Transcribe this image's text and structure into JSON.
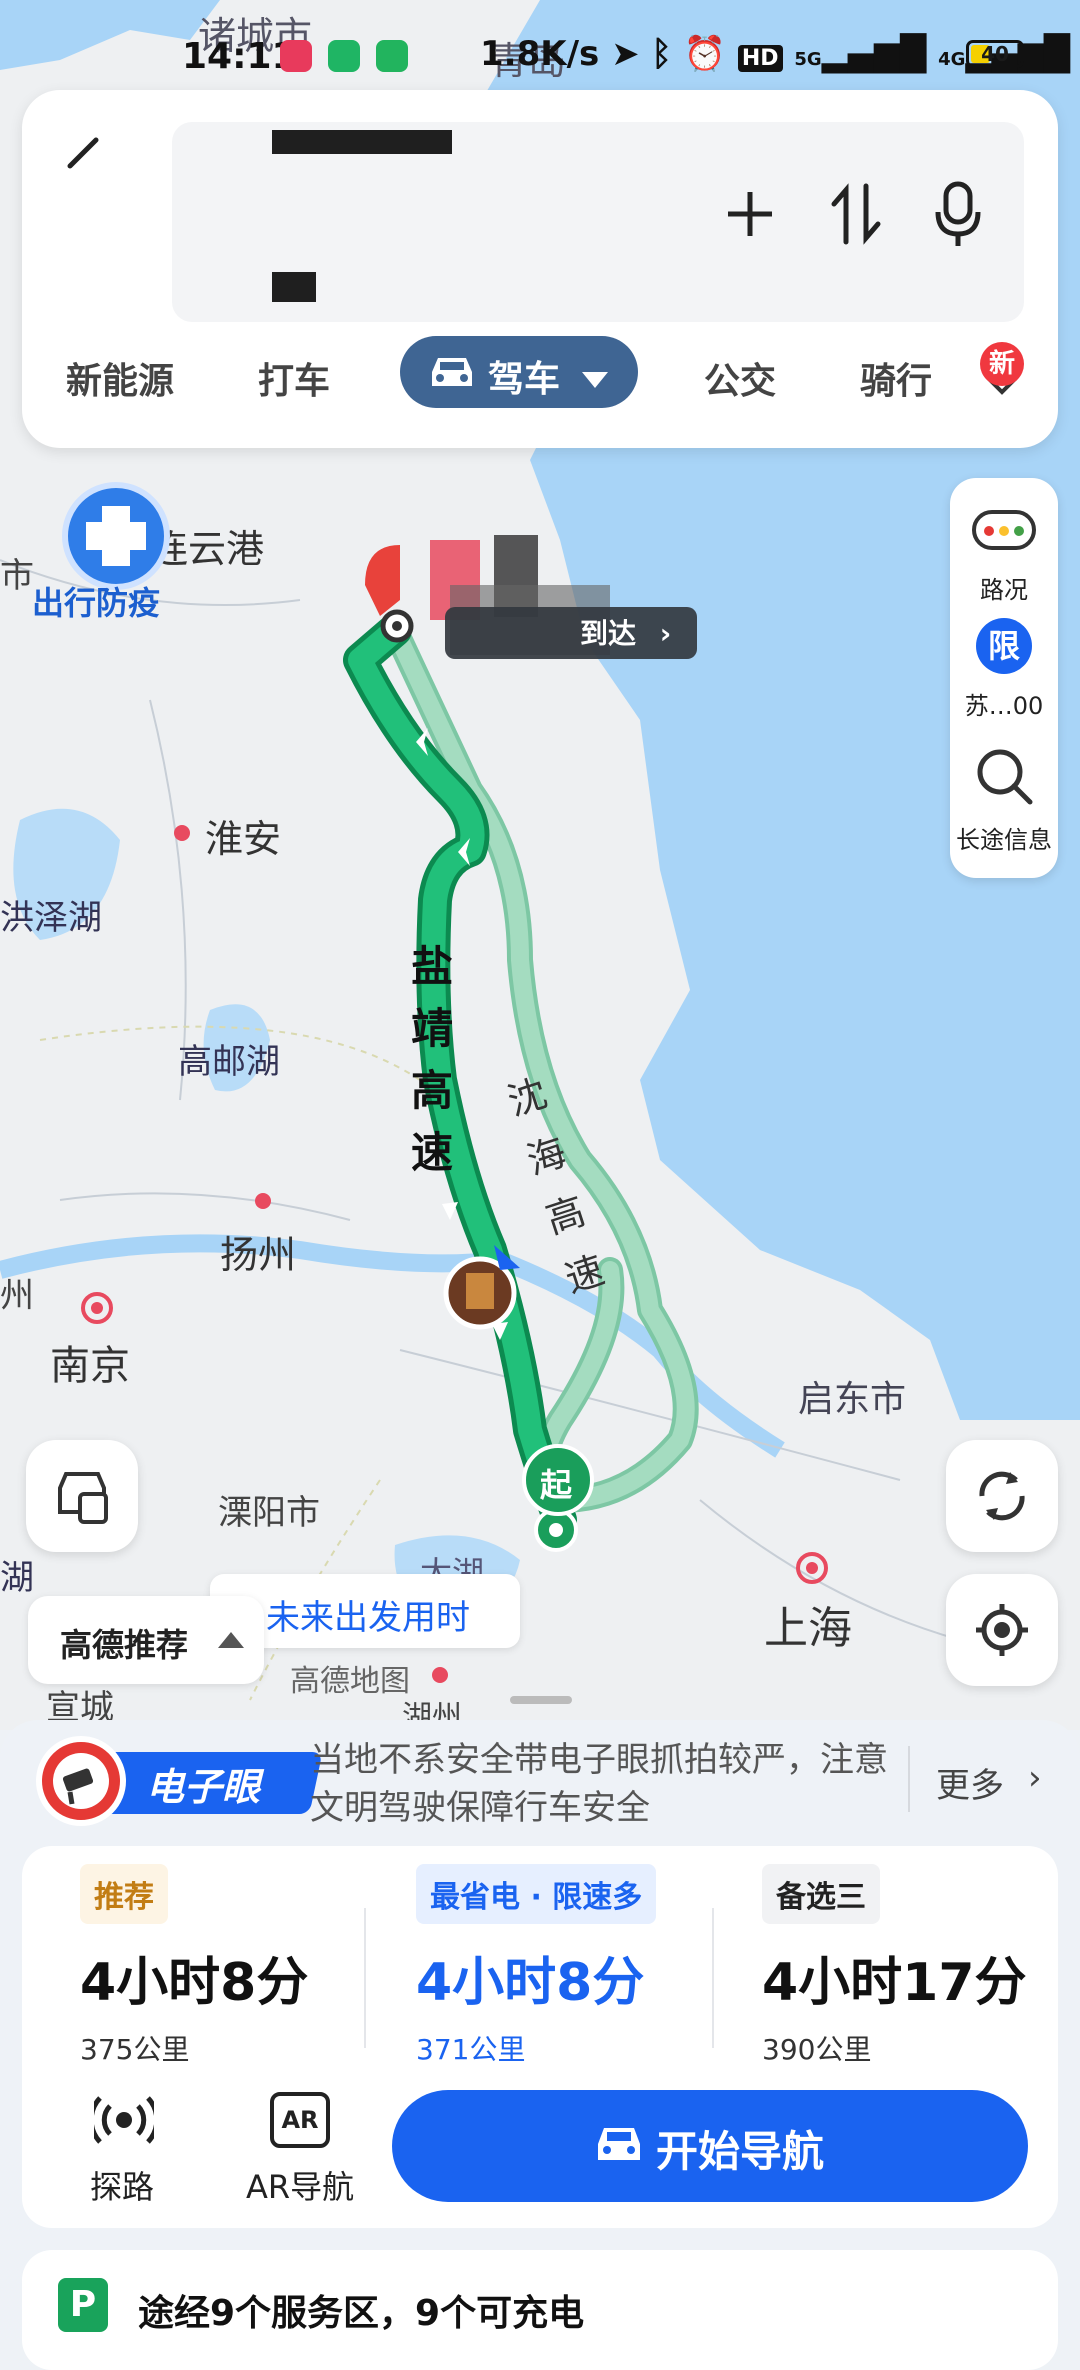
{
  "status_bar": {
    "time": "14:11",
    "network_speed": "1.8K/s",
    "battery": "40",
    "battery_level": 0.4,
    "signal_labels": [
      "5G",
      "4G"
    ]
  },
  "search": {
    "back_icon": "back-arrow-icon",
    "actions": [
      "add-waypoint-icon",
      "swap-icon",
      "microphone-icon"
    ]
  },
  "modes": {
    "tabs": [
      "新能源",
      "打车",
      "驾车",
      "公交",
      "骑行"
    ],
    "active": "驾车",
    "new_badge": "新"
  },
  "map": {
    "city_labels": [
      {
        "name": "诸城市"
      },
      {
        "name": "青岛"
      },
      {
        "name": "连云港"
      },
      {
        "name": "淮安"
      },
      {
        "name": "洪泽湖"
      },
      {
        "name": "高邮湖"
      },
      {
        "name": "扬州"
      },
      {
        "name": "南京"
      },
      {
        "name": "溧阳市"
      },
      {
        "name": "启东市"
      },
      {
        "name": "上海"
      },
      {
        "name": "太湖"
      },
      {
        "name": "宣城"
      },
      {
        "name": "湖州"
      },
      {
        "name": "湖"
      },
      {
        "name": "市"
      },
      {
        "name": "州"
      }
    ],
    "road_labels": {
      "main": [
        "盐",
        "靖",
        "高",
        "速"
      ],
      "alt": [
        "沈",
        "海",
        "高",
        "速"
      ]
    },
    "start_label": "起",
    "destination_badge": "到达",
    "epidemic_label": "出行防疫",
    "watermark": "高德地图",
    "future_departure": "未来出发用时",
    "recommend_label": "高德推荐"
  },
  "right_panel": {
    "traffic_label": "路况",
    "restriction_badge": "限",
    "restriction_label": "苏…00",
    "long_trip_label": "长途信息"
  },
  "alert": {
    "badge": "电子眼",
    "text": "当地不系安全带电子眼抓拍较严，注意文明驾驶保障行车安全",
    "more": "更多"
  },
  "routes": [
    {
      "tag": "推荐",
      "time": "4小时8分",
      "distance": "375公里"
    },
    {
      "tag": "最省电 · 限速多",
      "time": "4小时8分",
      "distance": "371公里"
    },
    {
      "tag": "备选三",
      "time": "4小时17分",
      "distance": "390公里"
    }
  ],
  "tools": [
    {
      "label": "探路",
      "icon": "explore-icon"
    },
    {
      "label": "AR导航",
      "icon": "ar-icon"
    }
  ],
  "start_navigation": "开始导航",
  "service_info": {
    "text": "途经9个服务区，9个可充电",
    "icon_letter": "P"
  },
  "colors": {
    "accent": "#1a63f0",
    "route_main": "#19b36b",
    "route_alt": "#8fd6b4",
    "active_tab": "#3f6593"
  }
}
